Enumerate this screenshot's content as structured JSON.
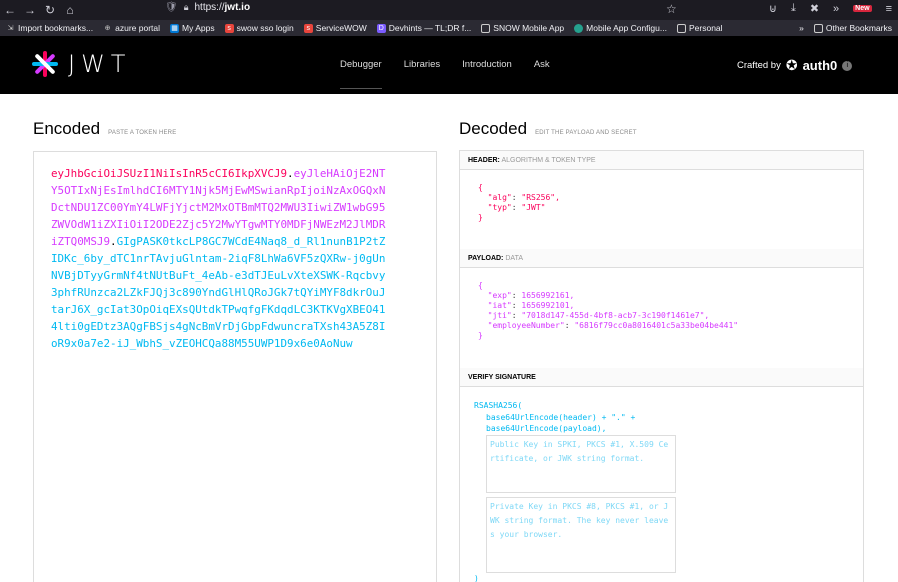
{
  "browser": {
    "url_prefix": "https://",
    "url_domain": "jwt.io",
    "new_badge": "New",
    "bookmarks": [
      {
        "label": "Import bookmarks...",
        "icon": "import-icon"
      },
      {
        "label": "azure portal",
        "icon": "globe-icon"
      },
      {
        "label": "My Apps",
        "icon": "apps-icon"
      },
      {
        "label": "swow sso login",
        "icon": "servicenow-icon"
      },
      {
        "label": "ServiceWOW",
        "icon": "servicenow-icon"
      },
      {
        "label": "Devhints — TL;DR f...",
        "icon": "devhints-icon"
      },
      {
        "label": "SNOW Mobile App",
        "icon": "folder-icon"
      },
      {
        "label": "Mobile App Configu...",
        "icon": "circle-icon"
      },
      {
        "label": "Personal",
        "icon": "folder-icon"
      }
    ],
    "other_bookmarks": "Other Bookmarks"
  },
  "header": {
    "logo_text": "JWT",
    "nav": [
      "Debugger",
      "Libraries",
      "Introduction",
      "Ask"
    ],
    "crafted_by": "Crafted by",
    "brand": "auth0"
  },
  "encoded": {
    "title": "Encoded",
    "hint": "PASTE A TOKEN HERE",
    "header_part": "eyJhbGciOiJSUzI1NiIsInR5cCI6IkpXVCJ9",
    "payload_part": "eyJleHAiOjE2NTY5OTIxNjEsImlhdCI6MTY1Njk5MjEwMSwianRpIjoiNzAxOGQxNDctNDU1ZC00YmY4LWFjYjctM2MxOTBmMTQ2MWU3IiwiZW1wbG95ZWVOdW1iZXIiOiI2ODE2Zjc5Y2MwYTgwMTY0MDFjNWEzM2JlMDRiZTQ0MSJ9",
    "signature_part": "GIgPASK0tkcLP8GC7WCdE4Naq8_d_Rl1nunB1P2tZIDKc_6by_dTC1nrTAvjuGlntam-2iqF8LhWa6VF5zQXRw-j0gUnNVBjDTyyGrmNf4tNUtBuFt_4eAb-e3dTJEuLvXteXSWK-Rqcbvy3phfRUnzca2LZkFJQj3c890YndGlHlQRoJGk7tQYiMYF8dkrOuJtarJ6X_gcIat3OpOiqEXsQUtdkTPwqfgFKdqdLC3KTKVgXBEO414lti0gEDtz3AQgFBSjs4gNcBmVrDjGbpFdwuncraTXsh43A5Z8IoR9x0a7e2-iJ_WbhS_vZEOHCQa88M55UWP1D9x6e0AoNuw"
  },
  "decoded": {
    "title": "Decoded",
    "hint": "EDIT THE PAYLOAD AND SECRET",
    "header_label": "HEADER:",
    "header_sub": "ALGORITHM & TOKEN TYPE",
    "header_json": [
      {
        "key": "\"alg\"",
        "value": "\"RS256\","
      },
      {
        "key": "\"typ\"",
        "value": "\"JWT\""
      }
    ],
    "payload_label": "PAYLOAD:",
    "payload_sub": "DATA",
    "payload_json": [
      {
        "key": "\"exp\"",
        "value": "1656992161,"
      },
      {
        "key": "\"iat\"",
        "value": "1656992101,"
      },
      {
        "key": "\"jti\"",
        "value": "\"7018d147-455d-4bf8-acb7-3c190f1461e7\","
      },
      {
        "key": "\"employeeNumber\"",
        "value": "\"6816f79cc0a8016401c5a33be04be441\""
      }
    ],
    "verify_label": "VERIFY SIGNATURE",
    "sig_fn": "RSASHA256(",
    "sig_line1": "base64UrlEncode(header) + \".\" +",
    "sig_line2": "base64UrlEncode(payload),",
    "public_key_placeholder": "Public Key in SPKI, PKCS #1, X.509 Certificate, or JWK string format.",
    "private_key_placeholder": "Private Key in PKCS #8, PKCS #1, or JWK string format. The key never leaves your browser.",
    "sig_close": ")"
  }
}
